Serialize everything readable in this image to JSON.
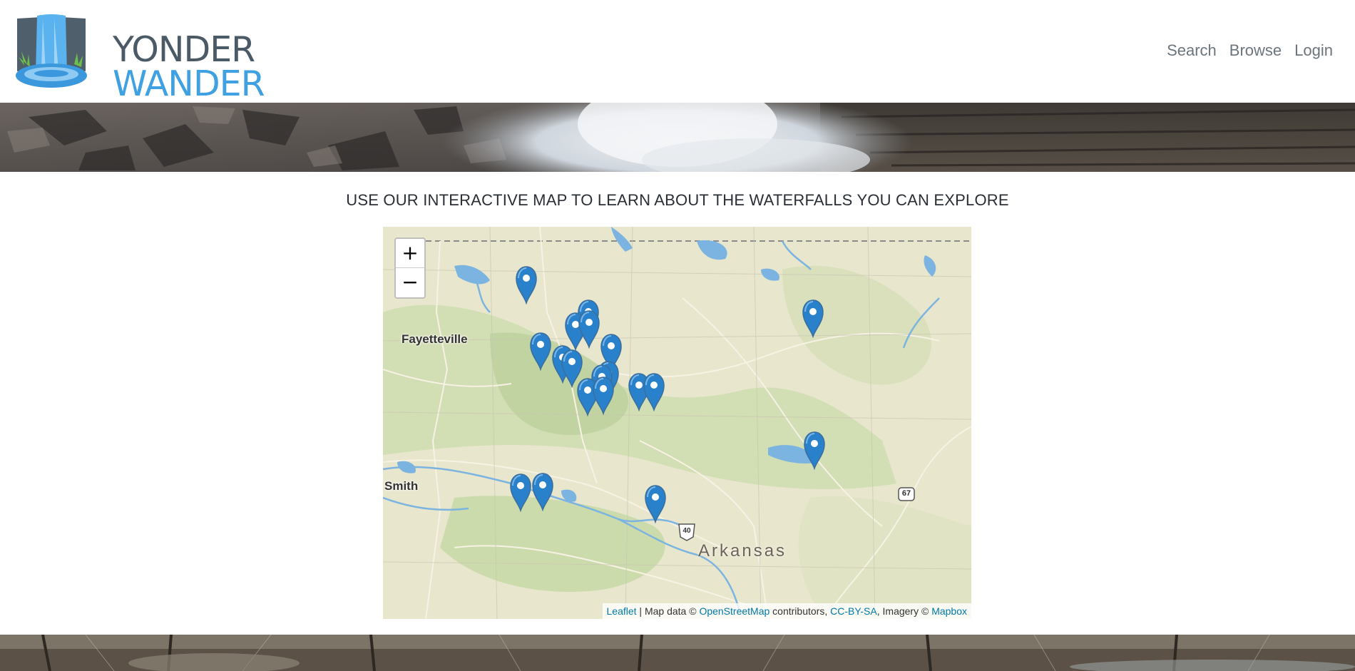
{
  "header": {
    "logo_line1": "YONDER",
    "logo_line2": "WANDER",
    "nav": [
      {
        "label": "Search"
      },
      {
        "label": "Browse"
      },
      {
        "label": "Login"
      }
    ]
  },
  "main": {
    "heading": "USE OUR INTERACTIVE MAP TO LEARN ABOUT THE WATERFALLS YOU CAN EXPLORE"
  },
  "map": {
    "zoom_in": "+",
    "zoom_out": "−",
    "labels": {
      "fayetteville": "Fayetteville",
      "smith": "Smith",
      "arkansas": "Arkansas",
      "shield_67": "67",
      "shield_40": "40"
    },
    "attribution": {
      "leaflet": "Leaflet",
      "sep1": " | Map data © ",
      "osm": "OpenStreetMap",
      "sep2": " contributors, ",
      "license": "CC-BY-SA",
      "sep3": ", Imagery © ",
      "mapbox": "Mapbox"
    },
    "marker_icon": "map-pin-icon",
    "marker_color": "#2a81cb",
    "marker_count": 19
  },
  "colors": {
    "logo_dark": "#4a5a66",
    "logo_blue": "#3fa0e2",
    "nav_text": "#6c757d",
    "link": "#0078a8"
  }
}
